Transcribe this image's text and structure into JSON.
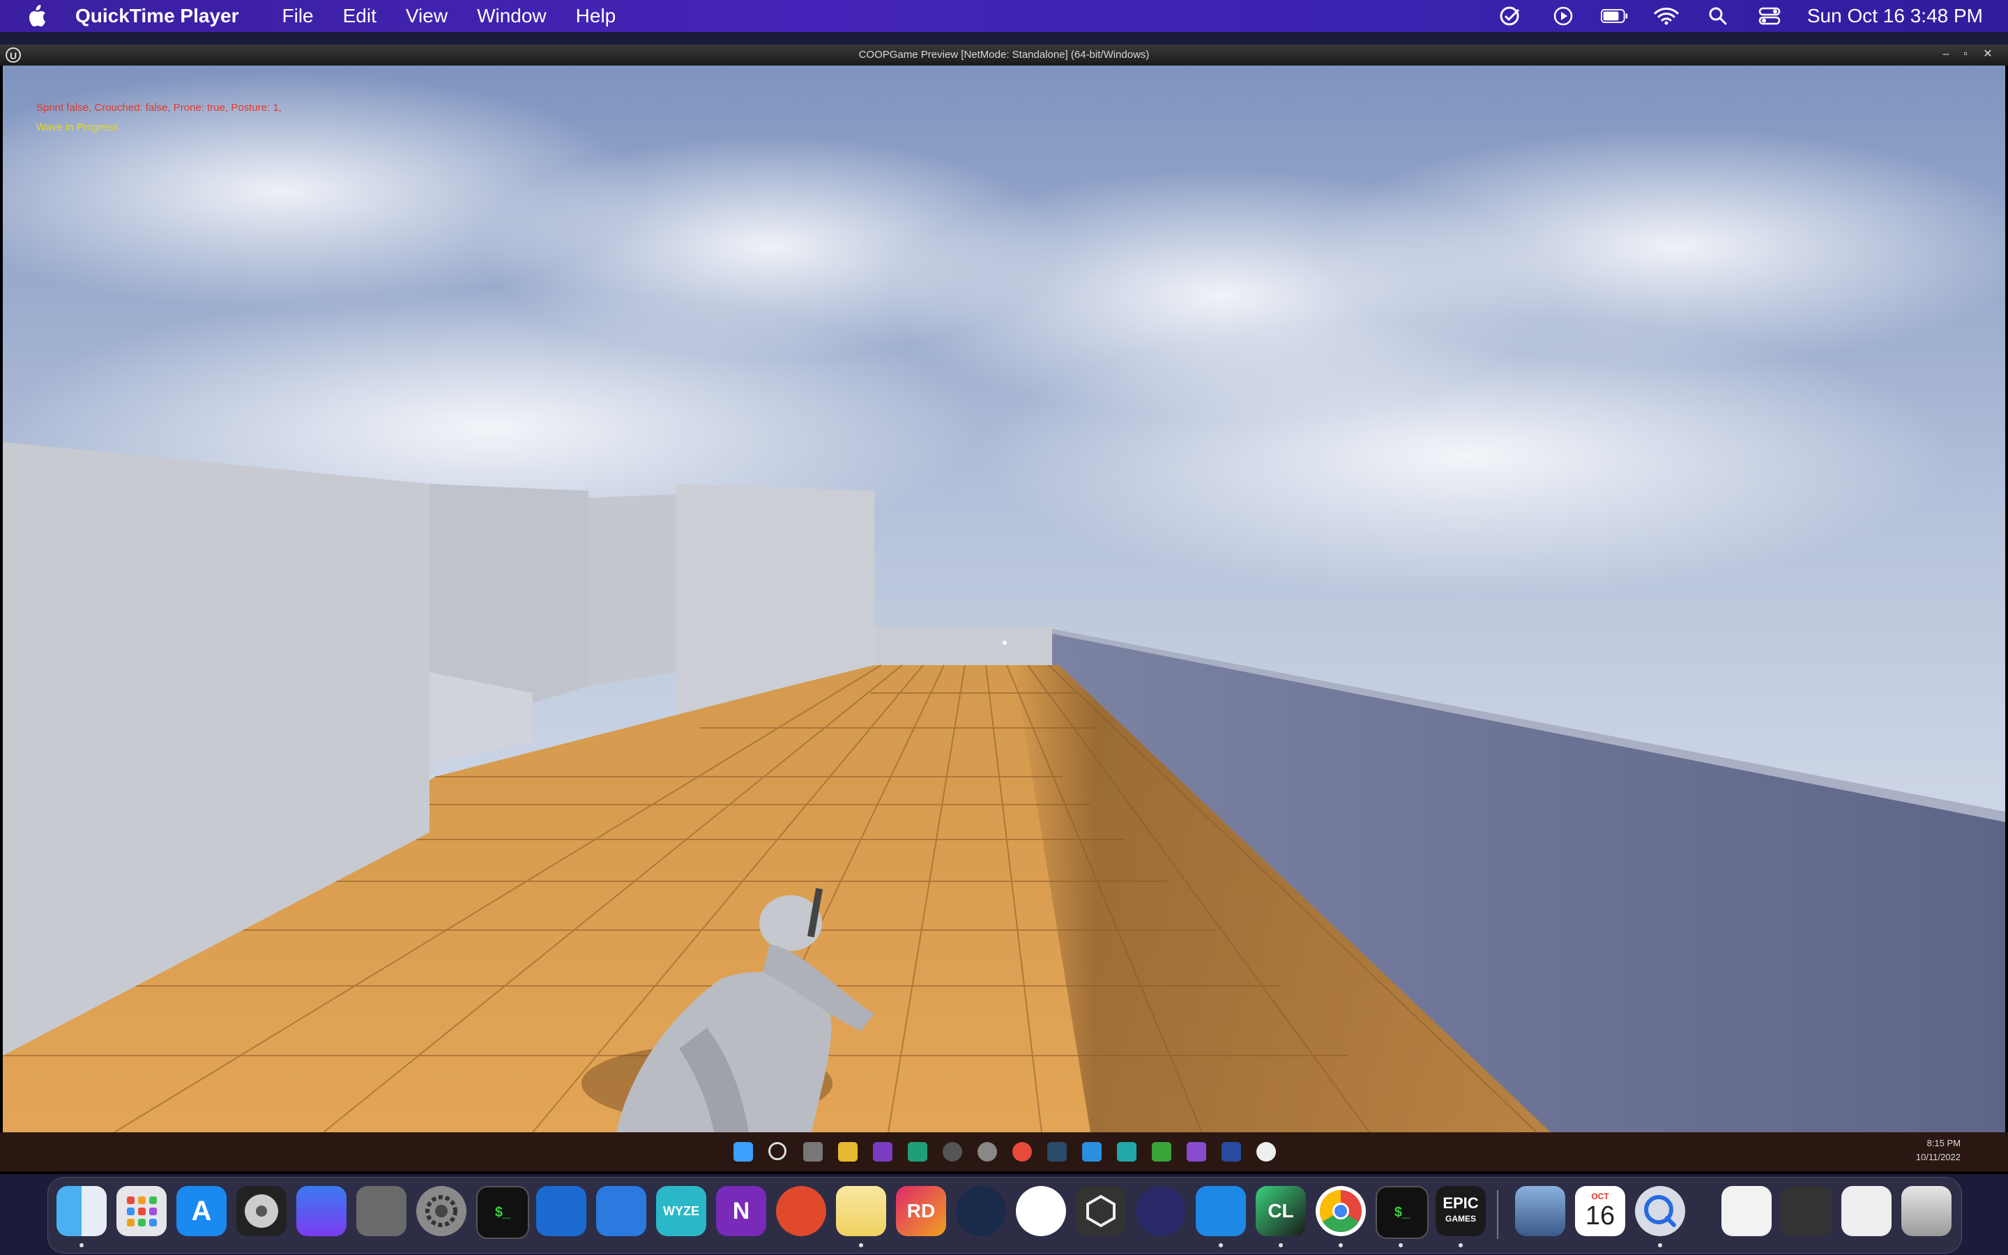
{
  "menubar": {
    "apple_icon": "apple-logo-icon",
    "app_name": "QuickTime Player",
    "items": [
      "File",
      "Edit",
      "View",
      "Window",
      "Help"
    ],
    "status_icons": [
      "checklist-icon",
      "play-circle-icon",
      "battery-icon",
      "wifi-icon",
      "search-icon",
      "control-center-icon"
    ],
    "clock": "Sun Oct 16  3:48 PM"
  },
  "game_window": {
    "title": "COOPGame Preview [NetMode: Standalone]  (64-bit/Windows)",
    "controls": [
      "minimize-icon",
      "maximize-icon",
      "close-icon"
    ],
    "debug_lines": [
      "Sprint false, Crouched: false, Prone: true, Posture: 1,",
      "Wave in Progress"
    ]
  },
  "win_taskbar": {
    "time": "8:15 PM",
    "date": "10/11/2022"
  },
  "dock": {
    "calendar_month": "OCT",
    "calendar_day": "16",
    "rd_label": "RD",
    "wyze_label": "WYZE",
    "clion_label": "CL",
    "epic_label_1": "EPIC",
    "epic_label_2": "GAMES",
    "onenote_label": "N",
    "terminal_label": "$_"
  },
  "colors": {
    "menubar_bg": "#4424b8",
    "floor": "#d89a4a",
    "sky": "#9fb0cf",
    "walls": "#c8ccd4"
  }
}
